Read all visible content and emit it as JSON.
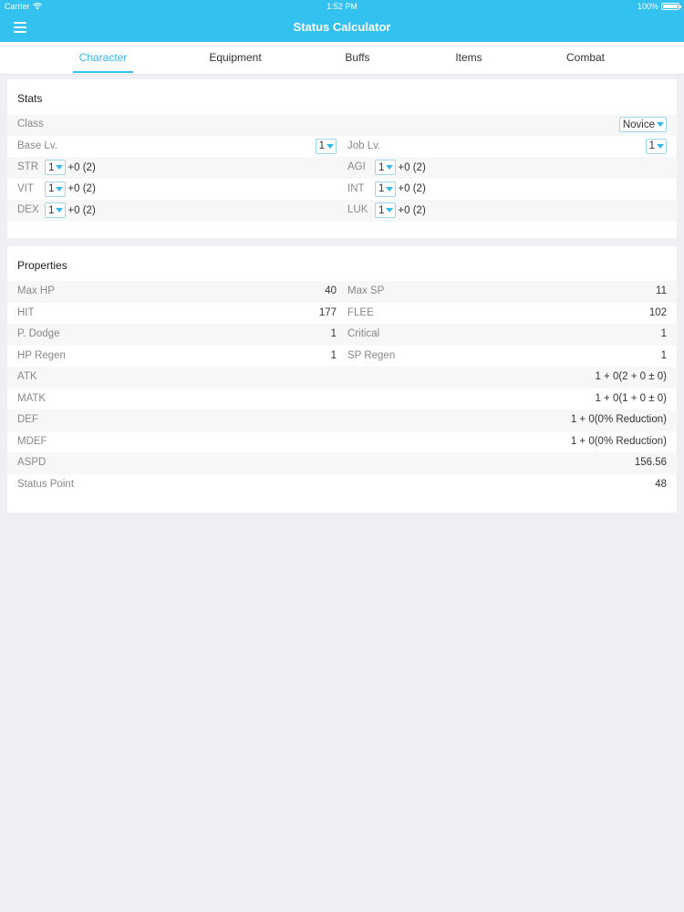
{
  "statusbar": {
    "carrier": "Carrier",
    "time": "1:52 PM",
    "battery": "100%"
  },
  "navbar": {
    "title": "Status Calculator",
    "menu_icon": "hamburger-menu-icon"
  },
  "tabs": [
    {
      "label": "Character",
      "active": true
    },
    {
      "label": "Equipment",
      "active": false
    },
    {
      "label": "Buffs",
      "active": false
    },
    {
      "label": "Items",
      "active": false
    },
    {
      "label": "Combat",
      "active": false
    }
  ],
  "stats": {
    "title": "Stats",
    "class_label": "Class",
    "class_value": "Novice",
    "base_lv_label": "Base Lv.",
    "base_lv_value": "1",
    "job_lv_label": "Job Lv.",
    "job_lv_value": "1",
    "attributes": [
      {
        "name": "STR",
        "value": "1",
        "bonus": "+0 (2)"
      },
      {
        "name": "AGI",
        "value": "1",
        "bonus": "+0 (2)"
      },
      {
        "name": "VIT",
        "value": "1",
        "bonus": "+0 (2)"
      },
      {
        "name": "INT",
        "value": "1",
        "bonus": "+0 (2)"
      },
      {
        "name": "DEX",
        "value": "1",
        "bonus": "+0 (2)"
      },
      {
        "name": "LUK",
        "value": "1",
        "bonus": "+0 (2)"
      }
    ]
  },
  "properties": {
    "title": "Properties",
    "pairs": [
      {
        "l_label": "Max HP",
        "l_value": "40",
        "r_label": "Max SP",
        "r_value": "11"
      },
      {
        "l_label": "HIT",
        "l_value": "177",
        "r_label": "FLEE",
        "r_value": "102"
      },
      {
        "l_label": "P. Dodge",
        "l_value": "1",
        "r_label": "Critical",
        "r_value": "1"
      },
      {
        "l_label": "HP Regen",
        "l_value": "1",
        "r_label": "SP Regen",
        "r_value": "1"
      }
    ],
    "singles": [
      {
        "label": "ATK",
        "value": "1 + 0(2 + 0 ± 0)"
      },
      {
        "label": "MATK",
        "value": "1 + 0(1 + 0 ± 0)"
      },
      {
        "label": "DEF",
        "value": "1 + 0(0% Reduction)"
      },
      {
        "label": "MDEF",
        "value": "1 + 0(0% Reduction)"
      },
      {
        "label": "ASPD",
        "value": "156.56"
      },
      {
        "label": "Status Point",
        "value": "48"
      }
    ]
  },
  "colors": {
    "accent": "#33c1f0",
    "background": "#efeff4",
    "row_alt": "#f7f7f8"
  }
}
